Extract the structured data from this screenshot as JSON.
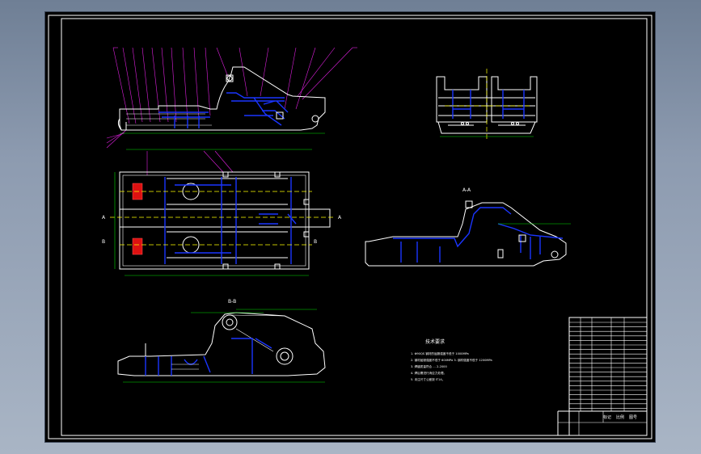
{
  "drawing": {
    "section_labels": {
      "view_a": "A-A",
      "view_b": "B-B",
      "marker_a": "A",
      "marker_b": "B"
    },
    "tech_requirements": {
      "title": "技术要求",
      "lines": [
        "1. Φ90QS 钢材的屈服强度不低于 1000MPa",
        "2. 钢材屈服强度不低于 600MPa  3. 钢材强度不低于 1200MPa",
        "3. 焊缝质量符合 … 2-2000",
        "4. 焊后需进行消应力处理。",
        "5. 未注尺寸公差按 IT14。"
      ]
    },
    "title_block": {
      "label_a": "标记",
      "label_b": "比例",
      "label_c": "图号"
    }
  },
  "colors": {
    "background_top": "#6f7f95",
    "viewport": "#000000",
    "line": "#ffffff",
    "structure": "#1a35ff",
    "dimension": "#00e000",
    "leader": "#e020e0",
    "centerline": "#ffff00",
    "hatch": "#dd1111"
  }
}
